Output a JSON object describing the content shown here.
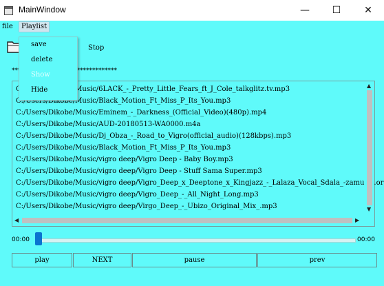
{
  "window": {
    "title": "MainWindow",
    "minimize": "—",
    "maximize": "☐",
    "close": "✕"
  },
  "menubar": {
    "file": "file",
    "playlist": "Playlist"
  },
  "toolbar": {
    "stop_label": "Stop",
    "stars": "**********************************"
  },
  "playlist_menu": {
    "save": "save",
    "delete": "delete",
    "show": "Show",
    "hide": "Hide"
  },
  "tracks": [
    "C:/Users/Dikobe/Music/6LACK_-_Pretty_Little_Fears_ft_J_Cole_talkglitz.tv.mp3",
    "C:/Users/Dikobe/Music/Black_Motion_Ft_Miss_P_Its_You.mp3",
    "C:/Users/Dikobe/Music/Eminem_-_Darkness_(Official_Video)(480p).mp4",
    "C:/Users/Dikobe/Music/AUD-20180513-WA0000.m4a",
    "C:/Users/Dikobe/Music/Dj_Obza_-_Road_to_Vigro(official_audio)(128kbps).mp3",
    "C:/Users/Dikobe/Music/Black_Motion_Ft_Miss_P_Its_You.mp3",
    "C:/Users/Dikobe/Music/vigro deep/Vigro Deep - Baby Boy.mp3",
    "C:/Users/Dikobe/Music/vigro deep/Vigro Deep - Stuff Sama Super.mp3",
    "C:/Users/Dikobe/Music/vigro deep/Vigro_Deep_x_Deeptone_x_Kingjazz_-_Lalaza_Vocal_Sdala_-zamusic.org",
    "C:/Users/Dikobe/Music/vigro deep/Vigro_Deep_-_All_Night_Long.mp3",
    "C:/Users/Dikobe/Music/vigro deep/Virgo_Deep_-_Ubizo_Original_Mix_.mp3"
  ],
  "player": {
    "time_start": "00:00",
    "time_end": "00:00",
    "position": 0
  },
  "buttons": {
    "play": "play",
    "next": "NEXT",
    "pause": "pause",
    "prev": "prev"
  },
  "colors": {
    "background": "#5ffafa",
    "slider_handle": "#0a74d0"
  }
}
